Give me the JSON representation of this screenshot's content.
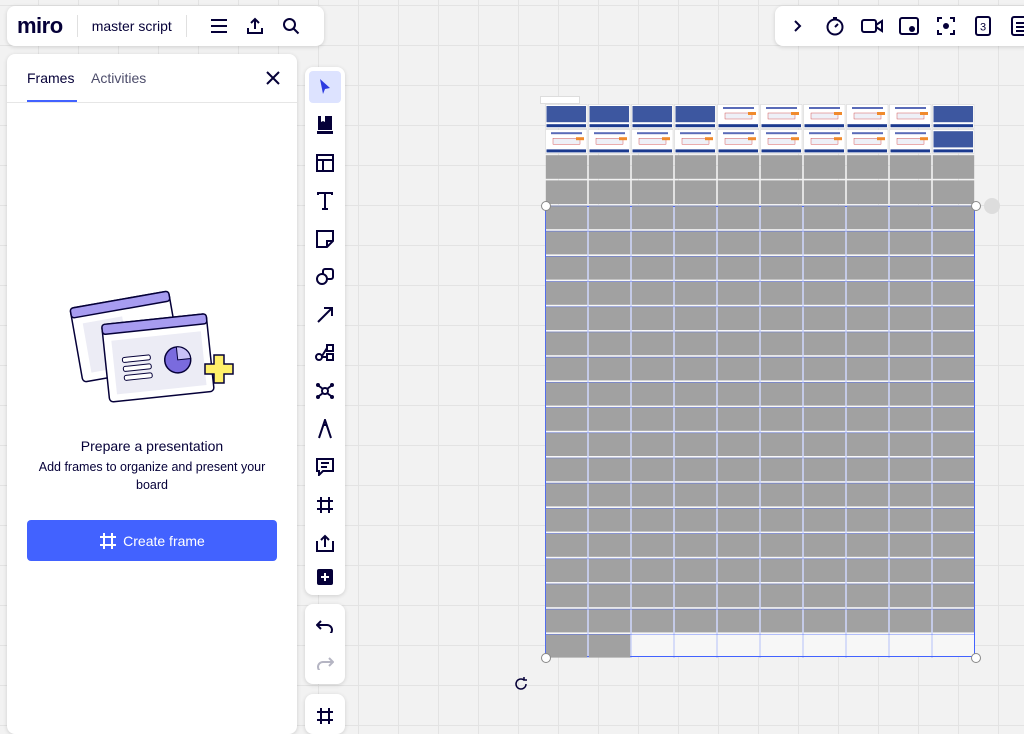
{
  "app": {
    "logo": "miro",
    "board_name": "master script"
  },
  "side_panel": {
    "tabs": [
      {
        "label": "Frames",
        "active": true
      },
      {
        "label": "Activities",
        "active": false
      }
    ],
    "empty_title": "Prepare a presentation",
    "empty_description": "Add frames to organize and present your board",
    "create_button": "Create frame"
  },
  "toolbar_right": {
    "items": [
      "chevron-right-icon",
      "timer-icon",
      "video-icon",
      "screen-share-icon",
      "focus-icon",
      "number-3-icon",
      "list-icon"
    ],
    "badge": "3"
  },
  "tools": [
    "select",
    "template",
    "table",
    "text",
    "sticky-note",
    "shapes",
    "arrow",
    "mindmap",
    "diagram",
    "pen",
    "comment",
    "frame",
    "upload",
    "more"
  ],
  "canvas": {
    "grid": {
      "columns": 10,
      "slide_rows": 2,
      "gray_rows": 19
    },
    "colors": {
      "accent": "#4262ff",
      "cell": "#a1a1a1",
      "slide_header": "#1b3a8f"
    }
  }
}
